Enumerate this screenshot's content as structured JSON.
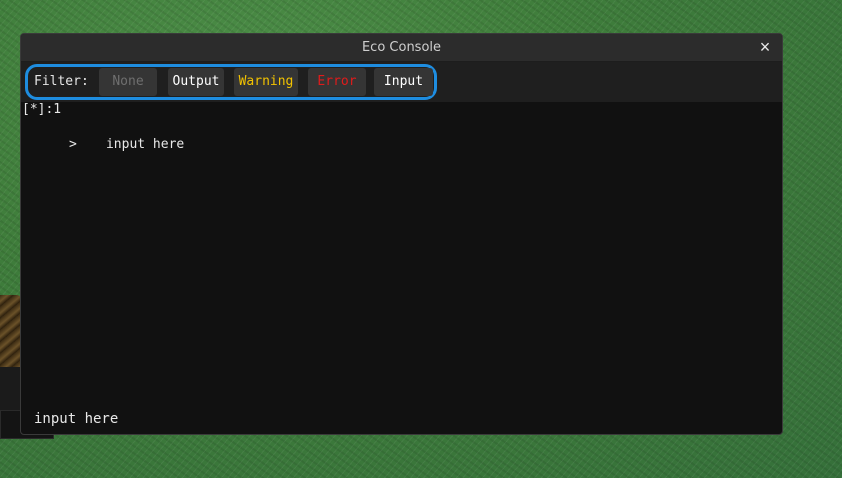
{
  "window": {
    "title": "Eco Console",
    "close_symbol": "×"
  },
  "filter": {
    "label": "Filter:",
    "buttons": [
      {
        "label": "None",
        "color": "#6f6f6f"
      },
      {
        "label": "Output",
        "color": "#ffffff"
      },
      {
        "label": "Warning",
        "color": "#f2c200"
      },
      {
        "label": "Error",
        "color": "#e01b1b"
      },
      {
        "label": "Input",
        "color": "#ffffff"
      }
    ],
    "highlight_color": "#1e8de0"
  },
  "output": {
    "lines": [
      {
        "text": "[*]:1"
      },
      {
        "prefix": ">",
        "text": "input here"
      }
    ]
  },
  "input": {
    "value": "input here"
  }
}
